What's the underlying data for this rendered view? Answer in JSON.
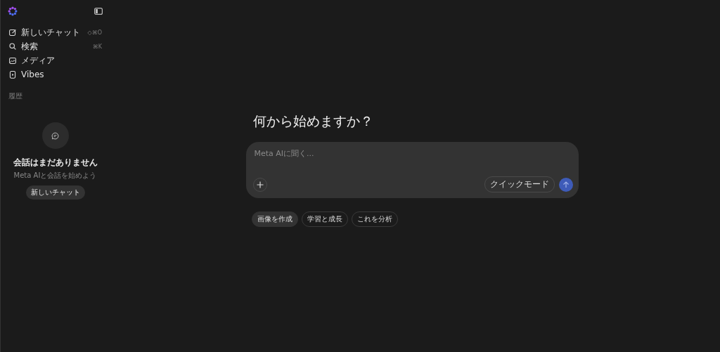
{
  "sidebar": {
    "nav": [
      {
        "kind": "compose",
        "label": "新しいチャット",
        "shortcut": "◇⌘O"
      },
      {
        "kind": "search",
        "label": "検索",
        "shortcut": "⌘K"
      },
      {
        "kind": "media",
        "label": "メディア"
      },
      {
        "kind": "video",
        "label": "Vibes"
      }
    ],
    "history_heading": "履歴",
    "empty": {
      "title": "会話はまだありません",
      "subtitle": "Meta AIと会話を始めよう",
      "button": "新しいチャット"
    }
  },
  "main": {
    "heading": "何から始めますか？",
    "composer": {
      "placeholder": "Meta AIに聞く...",
      "mode_button": "クイックモード"
    },
    "suggestions": [
      {
        "label": "画像を作成",
        "selected": true
      },
      {
        "label": "学習と成長",
        "selected": false
      },
      {
        "label": "これを分析",
        "selected": false
      }
    ]
  }
}
